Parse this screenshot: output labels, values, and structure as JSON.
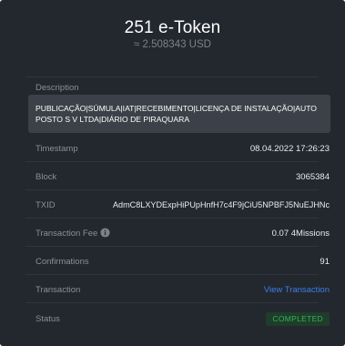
{
  "header": {
    "amount": "251 e-Token",
    "usd": "≈ 2.508343 USD"
  },
  "description": {
    "label": "Description",
    "text": "PUBLICAÇÃO|SÚMULA|IAT|RECEBIMENTO|LICENÇA DE INSTALAÇÃO|AUTO POSTO S V LTDA|DIÁRIO DE PIRAQUARA"
  },
  "rows": {
    "timestamp": {
      "label": "Timestamp",
      "value": "08.04.2022 17:26:23"
    },
    "block": {
      "label": "Block",
      "value": "3065384"
    },
    "txid": {
      "label": "TXID",
      "value": "AdmC8LXYDExpHiPUpHnfH7c4F9jCiU5NPBFJ5NuEJHNc"
    },
    "fee": {
      "label": "Transaction Fee",
      "value": "0.07 4Missions",
      "icon": "info-icon"
    },
    "confirmations": {
      "label": "Confirmations",
      "value": "91"
    },
    "transaction": {
      "label": "Transaction",
      "value": "View Transaction"
    },
    "status": {
      "label": "Status",
      "value": "COMPLETED"
    }
  },
  "colors": {
    "background": "#23272e",
    "link": "#3d7fe8",
    "status_text": "#34b35a",
    "status_bg": "#1f3d2a"
  }
}
